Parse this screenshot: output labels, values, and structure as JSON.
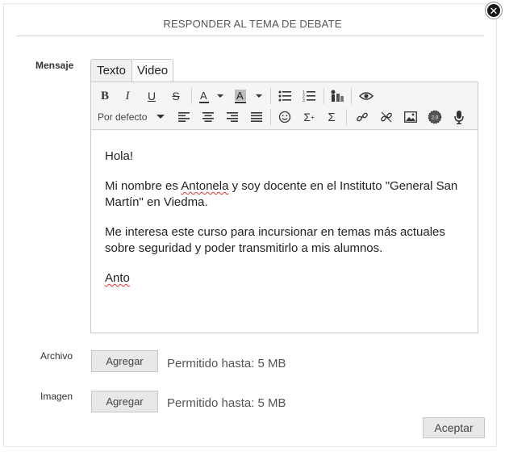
{
  "dialog": {
    "title": "RESPONDER AL TEMA DE DEBATE",
    "close_icon": "close-icon"
  },
  "form": {
    "mensaje_label": "Mensaje",
    "tabs": [
      {
        "label": "Texto",
        "active": true
      },
      {
        "label": "Video",
        "active": false
      }
    ],
    "toolbar": {
      "row1": [
        "bold-icon",
        "italic-icon",
        "underline-icon",
        "strikethrough-icon",
        "font-color-icon",
        "highlight-color-icon",
        "bulleted-list-icon",
        "numbered-list-icon",
        "accessibility-icon",
        "preview-icon"
      ],
      "format_select": "Por defecto",
      "row2": [
        "align-left-icon",
        "align-center-icon",
        "align-right-icon",
        "justify-icon",
        "emoji-icon",
        "equation-icon",
        "sigma-icon",
        "link-icon",
        "unlink-icon",
        "image-icon",
        "media-icon",
        "microphone-icon"
      ]
    },
    "message": {
      "p1": "Hola!",
      "p2_a": "Mi nombre es ",
      "p2_name": "Antonela",
      "p2_b": " y soy docente en el Instituto \"General San Martín\" en Viedma.",
      "p3": "Me interesa este curso para incursionar en temas más actuales sobre seguridad y poder transmitirlo a mis alumnos.",
      "signature": "Anto"
    },
    "archivo": {
      "label": "Archivo",
      "button": "Agregar",
      "hint": "Permitido hasta: 5 MB"
    },
    "imagen": {
      "label": "Imagen",
      "button": "Agregar",
      "hint": "Permitido hasta: 5 MB"
    },
    "submit": "Aceptar"
  }
}
